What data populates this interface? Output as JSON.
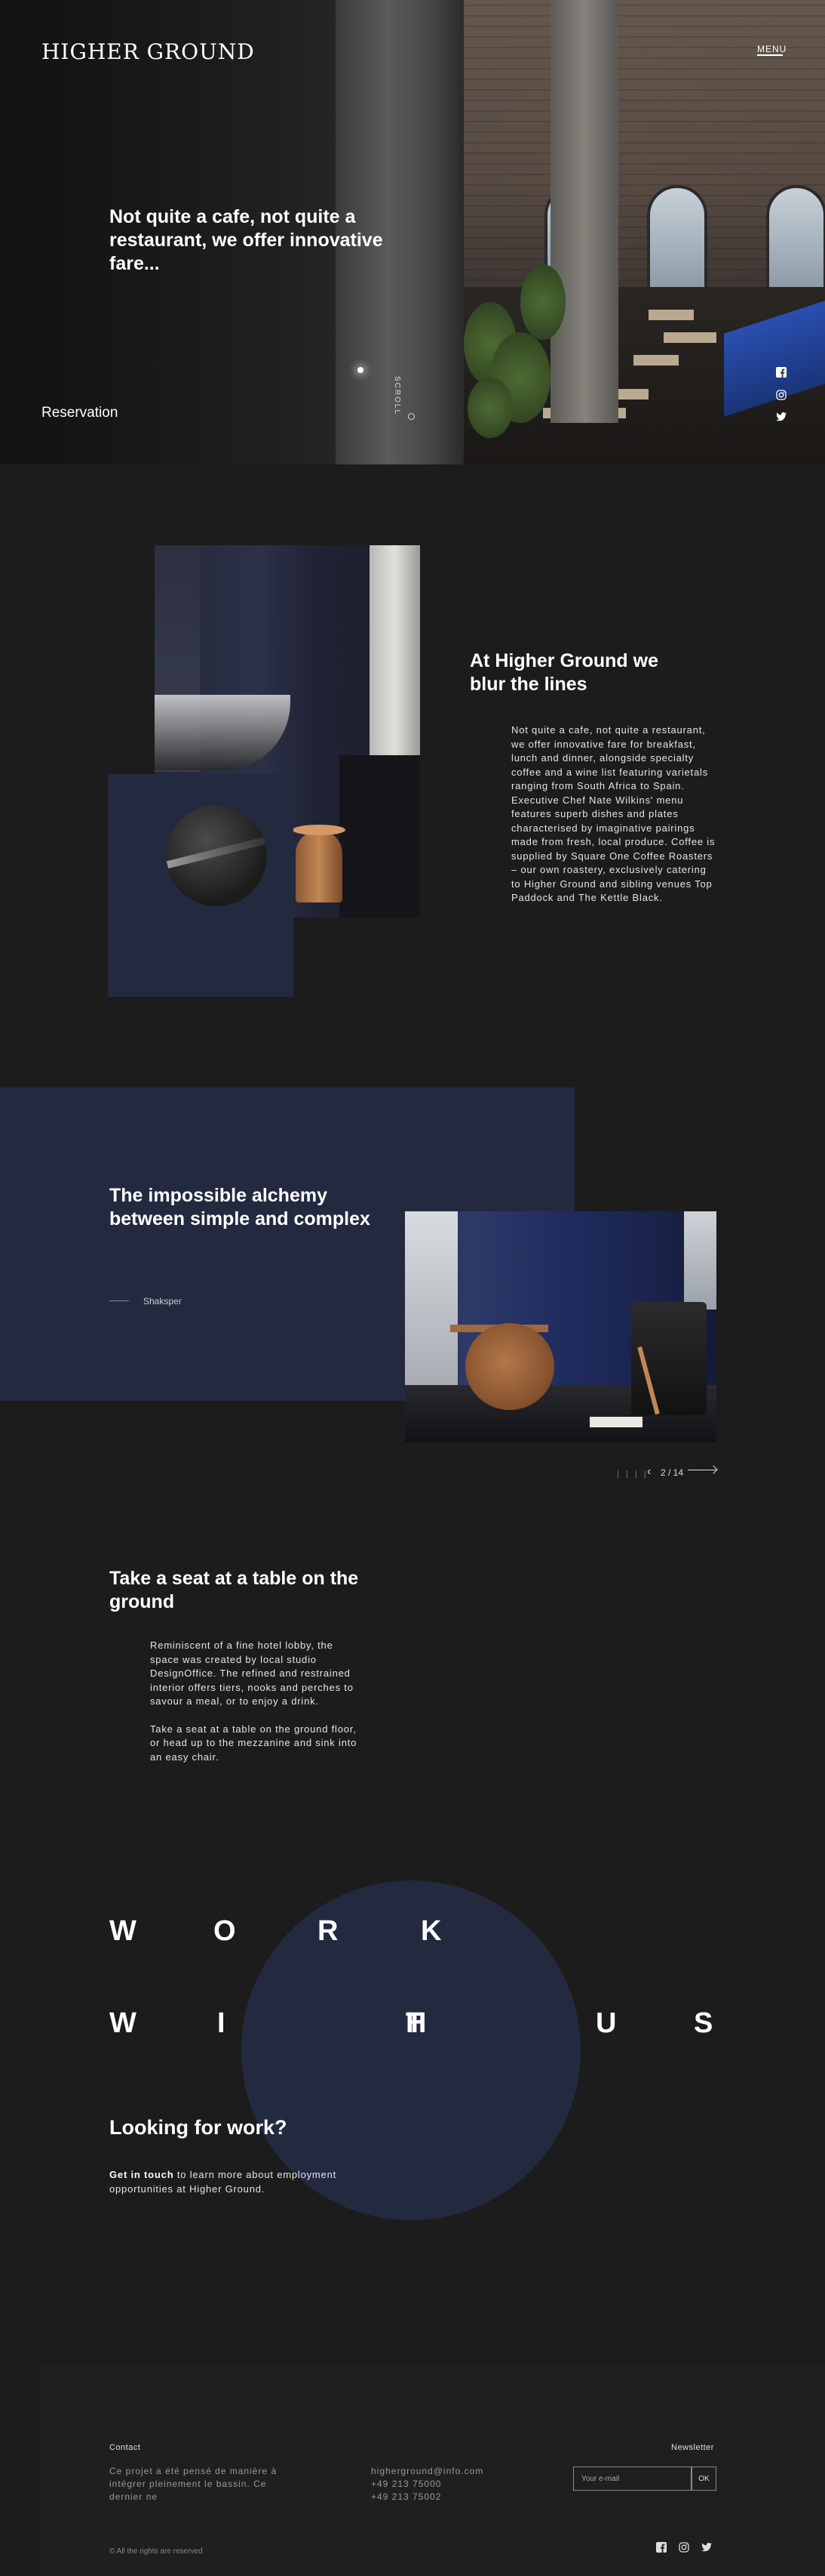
{
  "header": {
    "logo": "HIGHER GROUND",
    "menu_label": "MENU"
  },
  "hero": {
    "title": "Not quite a cafe, not quite a restaurant, we offer innovative fare...",
    "reservation_label": "Reservation",
    "scroll_label": "SCROLL",
    "social_icons": [
      "facebook-icon",
      "instagram-icon",
      "twitter-icon"
    ]
  },
  "about": {
    "heading": "At Higher Ground we blur the lines",
    "body": "Not quite a cafe, not quite a restaurant, we offer innovative fare for breakfast, lunch and dinner, alongside specialty coffee and a wine list featuring varietals ranging from South Africa to Spain. Executive Chef Nate Wilkins' menu features superb dishes and plates characterised by imaginative pairings made from fresh, local produce. Coffee is supplied by Square One Coffee Roasters – our own roastery, exclusively catering to Higher Ground and sibling venues Top Paddock and The Kettle Black."
  },
  "quote": {
    "heading": "The impossible alchemy between simple and complex",
    "author": "Shakspeг"
  },
  "slider": {
    "bars": "| | | |",
    "prev_symbol": "‹",
    "counter": "2 / 14"
  },
  "seat": {
    "heading": "Take a seat at a table on the ground",
    "paragraph_1": "Reminiscent of a fine hotel lobby, the space was created by local studio DesignOffice. The refined and restrained interior offers tiers, nooks and perches to savour a meal, or to enjoy a drink.",
    "paragraph_2": "Take a seat at a table on the ground floor, or head up to the mezzanine and sink into an easy chair."
  },
  "work": {
    "row1": [
      "W",
      "O",
      "R",
      "K"
    ],
    "row2": [
      "W",
      "I",
      "T",
      "H",
      "U",
      "S"
    ],
    "heading": "Looking for work?",
    "cta": "Get in touch",
    "body": "to learn more about employment opportunities at Higher Ground."
  },
  "footer": {
    "contact_label": "Contact",
    "contact_text": "Ce projet a été pensé de manière à intégrer pleinement le bassin. Ce dernier ne",
    "email": "higherground@info.com",
    "phone_1": "+49 213 75000",
    "phone_2": "+49 213 75002",
    "newsletter_label": "Newsletter",
    "newsletter_placeholder": "Your e-mail",
    "newsletter_button": "OK",
    "copyright": "© All the rights are reserved",
    "social_icons": [
      "facebook-icon",
      "instagram-icon",
      "twitter-icon"
    ]
  },
  "colors": {
    "background": "#1c1c1c",
    "navy": "#232a40",
    "accent_blue": "#2a4fb0"
  }
}
